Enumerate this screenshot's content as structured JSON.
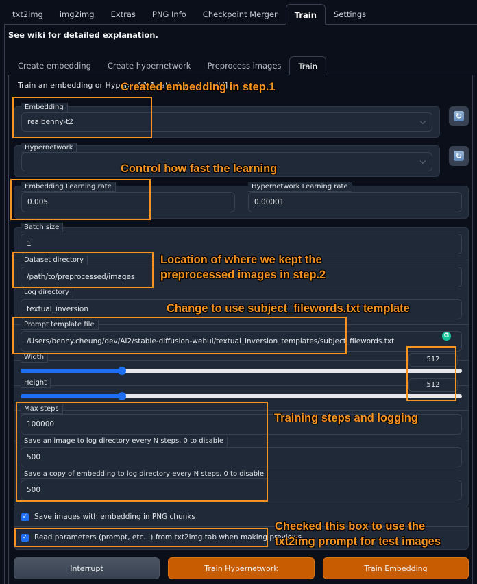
{
  "top_tabs": [
    {
      "label": "txt2img",
      "active": false
    },
    {
      "label": "img2img",
      "active": false
    },
    {
      "label": "Extras",
      "active": false
    },
    {
      "label": "PNG Info",
      "active": false
    },
    {
      "label": "Checkpoint Merger",
      "active": false
    },
    {
      "label": "Train",
      "active": true
    },
    {
      "label": "Settings",
      "active": false
    }
  ],
  "wiki_note": "See wiki for detailed explanation.",
  "sub_tabs": [
    {
      "label": "Create embedding",
      "active": false
    },
    {
      "label": "Create hypernetwork",
      "active": false
    },
    {
      "label": "Preprocess images",
      "active": false
    },
    {
      "label": "Train",
      "active": true
    }
  ],
  "description": "Train an embedding or Hyperr                                          of 1:1 ratio images [wiki]",
  "form": {
    "embedding": {
      "label": "Embedding",
      "value": "realbenny-t2"
    },
    "hypernetwork": {
      "label": "Hypernetwork",
      "value": ""
    },
    "embedding_lr": {
      "label": "Embedding Learning rate",
      "value": "0.005"
    },
    "hypernetwork_lr": {
      "label": "Hypernetwork Learning rate",
      "value": "0.00001"
    },
    "batch_size": {
      "label": "Batch size",
      "value": "1"
    },
    "dataset_dir": {
      "label": "Dataset directory",
      "value": "/path/to/preprocessed/images"
    },
    "log_dir": {
      "label": "Log directory",
      "value": "textual_inversion"
    },
    "prompt_template": {
      "label": "Prompt template file",
      "value": "/Users/benny.cheung/dev/AI2/stable-diffusion-webui/textual_inversion_templates/subject_filewords.txt"
    },
    "width": {
      "label": "Width",
      "value": "512",
      "fraction": 0.23
    },
    "height": {
      "label": "Height",
      "value": "512",
      "fraction": 0.23
    },
    "max_steps": {
      "label": "Max steps",
      "value": "100000"
    },
    "save_image_every": {
      "label": "Save an image to log directory every N steps, 0 to disable",
      "value": "500"
    },
    "save_embedding_every": {
      "label": "Save a copy of embedding to log directory every N steps, 0 to disable",
      "value": "500"
    },
    "save_png_chunks": {
      "label": "Save images with embedding in PNG chunks",
      "checked": true
    },
    "read_params": {
      "label": "Read parameters (prompt, etc...) from txt2img tab when making previews",
      "checked": true
    }
  },
  "icons": {
    "refresh": "↻",
    "checkmark": "✓",
    "grammarly": "G"
  },
  "buttons": {
    "interrupt": "Interrupt",
    "train_hypernetwork": "Train Hypernetwork",
    "train_embedding": "Train Embedding"
  },
  "annotations": {
    "step1": "Created embedding in step.1",
    "learning": "Control how fast the learning",
    "location_line1": "Location of where we kept the",
    "location_line2": "preprocessed images in step.2",
    "template": "Change to use subject_filewords.txt template",
    "steps": "Training steps and logging",
    "checkbox_line1": "Checked this box to use the",
    "checkbox_line2": "txt2img prompt for test images"
  },
  "colors": {
    "accent_orange": "#c85c00",
    "annotation_orange": "#f7931e",
    "slider_blue": "#1d6ef0",
    "background": "#0b0f19",
    "panel": "#1f2937"
  }
}
